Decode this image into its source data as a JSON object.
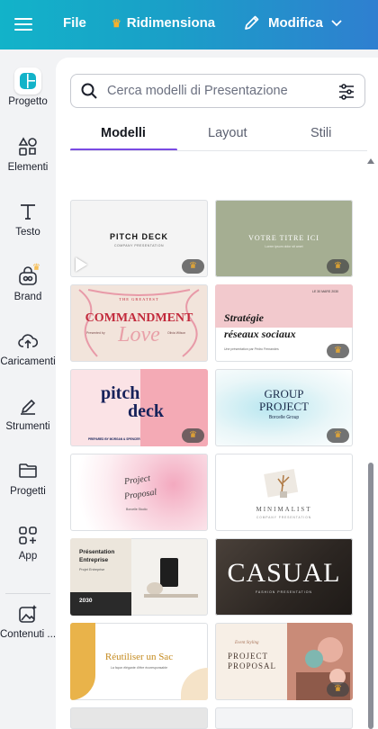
{
  "topbar": {
    "file_label": "File",
    "resize_label": "Ridimensiona",
    "edit_label": "Modifica"
  },
  "sidebar": {
    "items": [
      {
        "label": "Progetto",
        "icon": "canva-logo-icon"
      },
      {
        "label": "Elementi",
        "icon": "shapes-icon"
      },
      {
        "label": "Testo",
        "icon": "text-icon"
      },
      {
        "label": "Brand",
        "icon": "brand-kit-icon"
      },
      {
        "label": "Caricamenti",
        "icon": "upload-cloud-icon"
      },
      {
        "label": "Strumenti",
        "icon": "draw-tools-icon"
      },
      {
        "label": "Progetti",
        "icon": "folder-icon"
      },
      {
        "label": "App",
        "icon": "apps-grid-icon"
      },
      {
        "label": "Contenuti ...",
        "icon": "magic-media-icon"
      }
    ]
  },
  "search": {
    "placeholder": "Cerca modelli di Presentazione",
    "value": ""
  },
  "tabs": [
    {
      "label": "Modelli",
      "active": true
    },
    {
      "label": "Layout",
      "active": false
    },
    {
      "label": "Stili",
      "active": false
    }
  ],
  "colors": {
    "accent": "#7a4be3",
    "crown": "#f7b02c",
    "topbar_start": "#12b3c9",
    "topbar_end": "#2f7fd0"
  },
  "templates": [
    {
      "title": "PITCH DECK",
      "subtitle": "COMPANY PRESENTATION",
      "premium": true,
      "video": true
    },
    {
      "title": "VOTRE TITRE ICI",
      "subtitle": "Lorem ipsum dolor sit amet",
      "premium": true,
      "video": false
    },
    {
      "kicker": "THE GREATEST",
      "title": "COMMANDMENT",
      "script": "Love",
      "left_note": "Presented by",
      "right_note": "Olivia Wilson",
      "premium": false,
      "video": false
    },
    {
      "title": "Stratégie",
      "title2": "réseaux sociaux",
      "note": "LE 30 MARS 2030",
      "footer": "Une présentation par Pédro Fernandes",
      "premium": true,
      "video": false
    },
    {
      "title": "pitch",
      "title2": "deck",
      "footer": "PREPARED BY MORGAN & SPENCER",
      "premium": true,
      "video": false
    },
    {
      "title": "GROUP",
      "title2": "PROJECT",
      "subtitle": "Borcelle Group",
      "premium": true,
      "video": false
    },
    {
      "title": "Project",
      "title2": "Proposal",
      "subtitle": "Borcelle Studio",
      "premium": false,
      "video": false
    },
    {
      "title": "MINIMALIST",
      "subtitle": "COMPANY PRESENTATION",
      "premium": false,
      "video": false
    },
    {
      "title": "Présentation",
      "title2": "Entreprise",
      "subtitle": "Projet Entreprise",
      "year": "2030",
      "premium": false,
      "video": false
    },
    {
      "title": "CASUAL",
      "subtitle": "FASHION PRESENTATION",
      "premium": false,
      "video": false
    },
    {
      "title": "Réutiliser un Sac",
      "subtitle": "La façon élégante d'être écoresponsable",
      "premium": false,
      "video": false
    },
    {
      "kicker": "Event Styling",
      "title": "PROJECT",
      "title2": "PROPOSAL",
      "premium": true,
      "video": false
    }
  ]
}
